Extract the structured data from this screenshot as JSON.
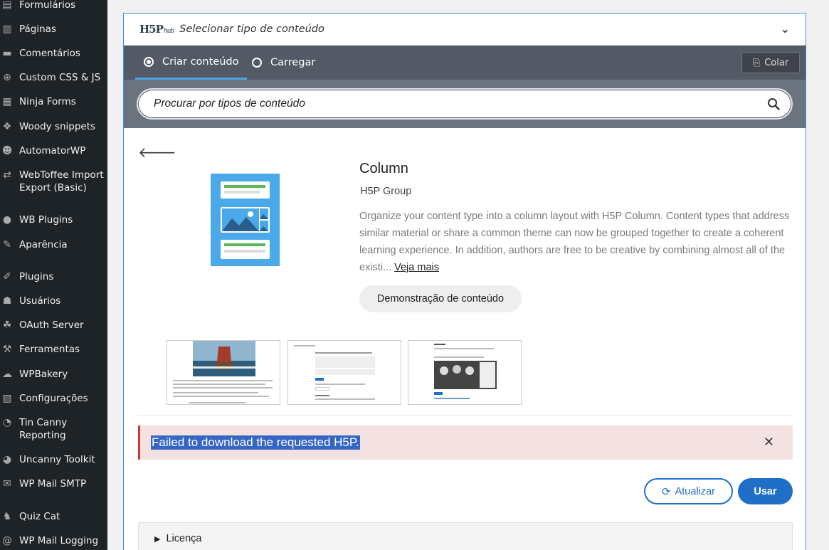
{
  "sidebar": {
    "items": [
      {
        "label": "Formulários",
        "icon": "forms-icon",
        "glyph": "▤"
      },
      {
        "label": "Páginas",
        "icon": "pages-icon",
        "glyph": "▥"
      },
      {
        "label": "Comentários",
        "icon": "comments-icon",
        "glyph": "▬"
      },
      {
        "label": "Custom CSS & JS",
        "icon": "plus-circle-icon",
        "glyph": "⊕"
      },
      {
        "label": "Ninja Forms",
        "icon": "ninja-forms-icon",
        "glyph": "▦"
      },
      {
        "label": "Woody snippets",
        "icon": "code-icon",
        "glyph": "❖"
      },
      {
        "label": "AutomatorWP",
        "icon": "robot-icon",
        "glyph": "☻"
      },
      {
        "label": "WebToffee Import Export (Basic)",
        "icon": "import-export-icon",
        "glyph": "⇄"
      },
      {
        "label": "WB Plugins",
        "icon": "lightbulb-icon",
        "glyph": "●"
      },
      {
        "label": "Aparência",
        "icon": "paintbrush-icon",
        "glyph": "✎"
      },
      {
        "label": "Plugins",
        "icon": "plugins-icon",
        "glyph": "✐"
      },
      {
        "label": "Usuários",
        "icon": "users-icon",
        "glyph": "☗"
      },
      {
        "label": "OAuth Server",
        "icon": "groups-icon",
        "glyph": "☘"
      },
      {
        "label": "Ferramentas",
        "icon": "wrench-icon",
        "glyph": "⚒"
      },
      {
        "label": "WPBakery",
        "icon": "wpbakery-icon",
        "glyph": "☁"
      },
      {
        "label": "Configurações",
        "icon": "settings-icon",
        "glyph": "▧"
      },
      {
        "label": "Tin Canny Reporting",
        "icon": "tincanny-icon",
        "glyph": "◔"
      },
      {
        "label": "Uncanny Toolkit",
        "icon": "uncanny-icon",
        "glyph": "◕"
      },
      {
        "label": "WP Mail SMTP",
        "icon": "mail-icon",
        "glyph": "✉"
      },
      {
        "label": "Quiz Cat",
        "icon": "quizcat-icon",
        "glyph": "♞"
      },
      {
        "label": "WP Mail Logging",
        "icon": "at-icon",
        "glyph": "@"
      }
    ]
  },
  "hub": {
    "logo": "H5P",
    "logo_sub": "hub",
    "title": "Selecionar tipo de conteúdo",
    "chevron": "⌄",
    "tabs": [
      {
        "label": "Criar conteúdo"
      },
      {
        "label": "Carregar"
      }
    ],
    "paste_label": "Colar",
    "search_placeholder": "Procurar por tipos de conteúdo"
  },
  "content": {
    "title": "Column",
    "owner": "H5P Group",
    "description": "Organize your content type into a column layout with H5P Column. Content types that address similar material or share a common theme can now be grouped together to create a coherent learning experience. In addition, authors are free to be creative by combining almost all of the existi...",
    "read_more": "Veja mais",
    "demo_label": "Demonstração de conteúdo",
    "error_message": "Failed to download the requested H5P.",
    "update_label": "Atualizar",
    "use_label": "Usar",
    "license_label": "Licença"
  },
  "colors": {
    "accent": "#1f6fc6",
    "tabbar": "#535a65",
    "searchbar": "#6b737e",
    "error_bg": "#f4e2e2",
    "sidebar_bg": "#1d2327"
  }
}
